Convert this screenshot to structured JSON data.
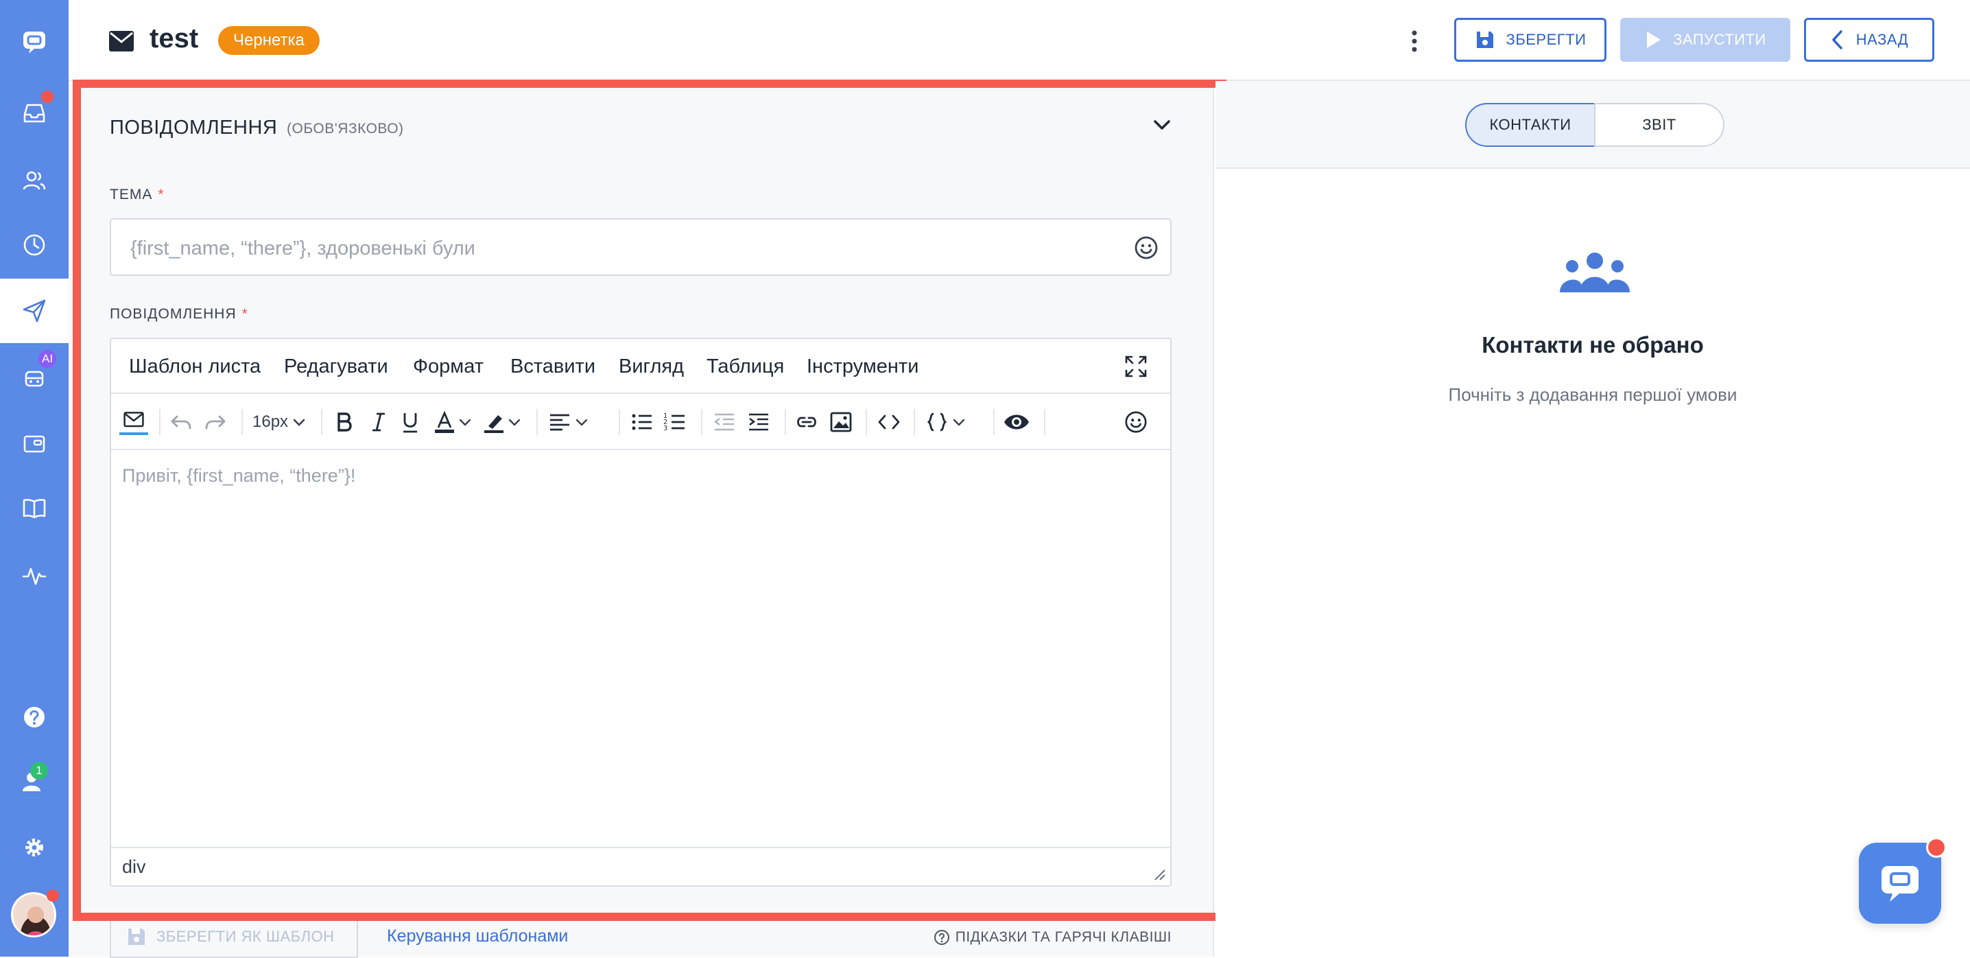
{
  "colors": {
    "sidebar": "#5a89e6",
    "accent": "#3a6fd8",
    "draft_badge": "#f28d0f",
    "highlight": "#f45a4f",
    "notification": "#f2544b"
  },
  "sidebar": {
    "items": [
      {
        "icon": "chat-logo-icon"
      },
      {
        "icon": "inbox-icon"
      },
      {
        "icon": "contacts-icon"
      },
      {
        "icon": "history-icon"
      },
      {
        "icon": "send-icon",
        "active": true
      },
      {
        "icon": "bot-icon",
        "badge": "AI"
      },
      {
        "icon": "wallet-icon"
      },
      {
        "icon": "book-icon"
      },
      {
        "icon": "activity-icon"
      },
      {
        "icon": "help-icon"
      },
      {
        "icon": "users-icon",
        "badge": "1"
      },
      {
        "icon": "gear-icon"
      }
    ],
    "ai_badge": "AI",
    "users_badge": "1"
  },
  "header": {
    "title": "test",
    "status": "Чернетка",
    "save_label": "ЗБЕРЕГТИ",
    "run_label": "ЗАПУСТИТИ",
    "back_label": "НАЗАД"
  },
  "message_section": {
    "title": "ПОВІДОМЛЕННЯ",
    "note": "(ОБОВ'ЯЗКОВО)",
    "subject_label": "ТЕМА",
    "subject_placeholder": "{first_name, “there”}, здоровенькі були",
    "message_label": "ПОВІДОМЛЕННЯ",
    "required_mark": "*"
  },
  "editor": {
    "menu": [
      "Шаблон листа",
      "Редагувати",
      "Формат",
      "Вставити",
      "Вигляд",
      "Таблиця",
      "Інструменти"
    ],
    "font_size": "16px",
    "body_placeholder": "Привіт, {first_name, “there”}!",
    "status_path": "div"
  },
  "bottom_bar": {
    "save_template": "ЗБЕРЕГТИ ЯК ШАБЛОН",
    "manage_templates": "Керування шаблонами",
    "hints": "ПІДКАЗКИ ТА ГАРЯЧІ КЛАВІШІ"
  },
  "right_panel": {
    "tabs": [
      "КОНТАКТИ",
      "ЗВІТ"
    ],
    "active_tab": "КОНТАКТИ",
    "empty_title": "Контакти не обрано",
    "empty_subtitle": "Почніть з додавання першої умови"
  }
}
